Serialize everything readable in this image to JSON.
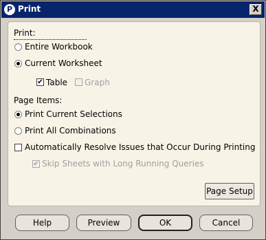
{
  "window": {
    "title": "Print",
    "close_label": "X",
    "icon_letter": "P"
  },
  "print_section": {
    "label": "Print:",
    "options": [
      {
        "label": "Entire Workbook",
        "selected": false
      },
      {
        "label": "Current Worksheet",
        "selected": true
      }
    ],
    "sub_options": [
      {
        "label": "Table",
        "checked": true,
        "enabled": true
      },
      {
        "label": "Graph",
        "checked": false,
        "enabled": false
      }
    ]
  },
  "page_items": {
    "label": "Page Items:",
    "options": [
      {
        "label": "Print Current Selections",
        "selected": true
      },
      {
        "label": "Print All Combinations",
        "selected": false
      }
    ]
  },
  "auto_resolve": {
    "label": "Automatically Resolve Issues that Occur During Printing",
    "checked": false
  },
  "skip_sheets": {
    "label": "Skip Sheets with Long Running Queries",
    "checked": true,
    "enabled": false
  },
  "buttons": {
    "page_setup": "Page Setup",
    "help": "Help",
    "preview": "Preview",
    "ok": "OK",
    "cancel": "Cancel"
  }
}
